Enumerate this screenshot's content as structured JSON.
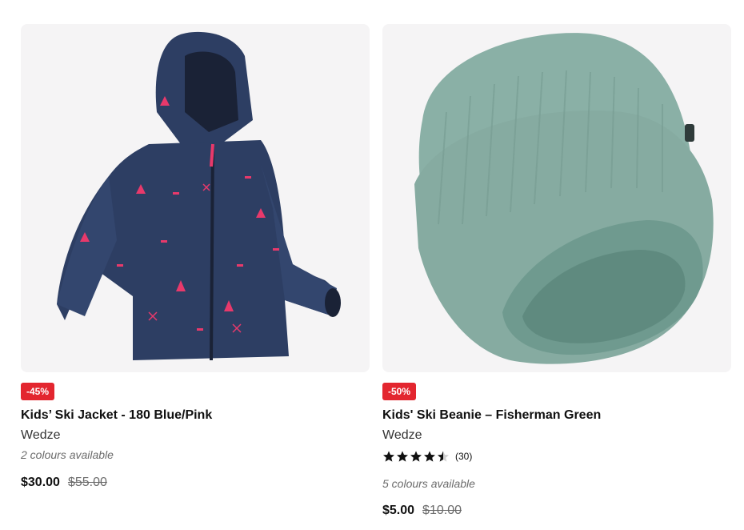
{
  "products": [
    {
      "badge": "-45%",
      "title": "Kids’ Ski Jacket - 180 Blue/Pink",
      "brand": "Wedze",
      "colours": "2 colours available",
      "price": "$30.00",
      "old_price": "$55.00",
      "image_icon": "ski-jacket-image"
    },
    {
      "badge": "-50%",
      "title": "Kids' Ski Beanie – Fisherman Green",
      "brand": "Wedze",
      "rating": 4.5,
      "rating_count": "(30)",
      "colours": "5 colours available",
      "price": "$5.00",
      "old_price": "$10.00",
      "image_icon": "beanie-image"
    }
  ],
  "colors": {
    "badge_bg": "#e3262f",
    "image_bg": "#f5f4f5",
    "jacket": "#2d3e63",
    "jacket_accent": "#e8396b",
    "beanie": "#8ab0a6"
  }
}
